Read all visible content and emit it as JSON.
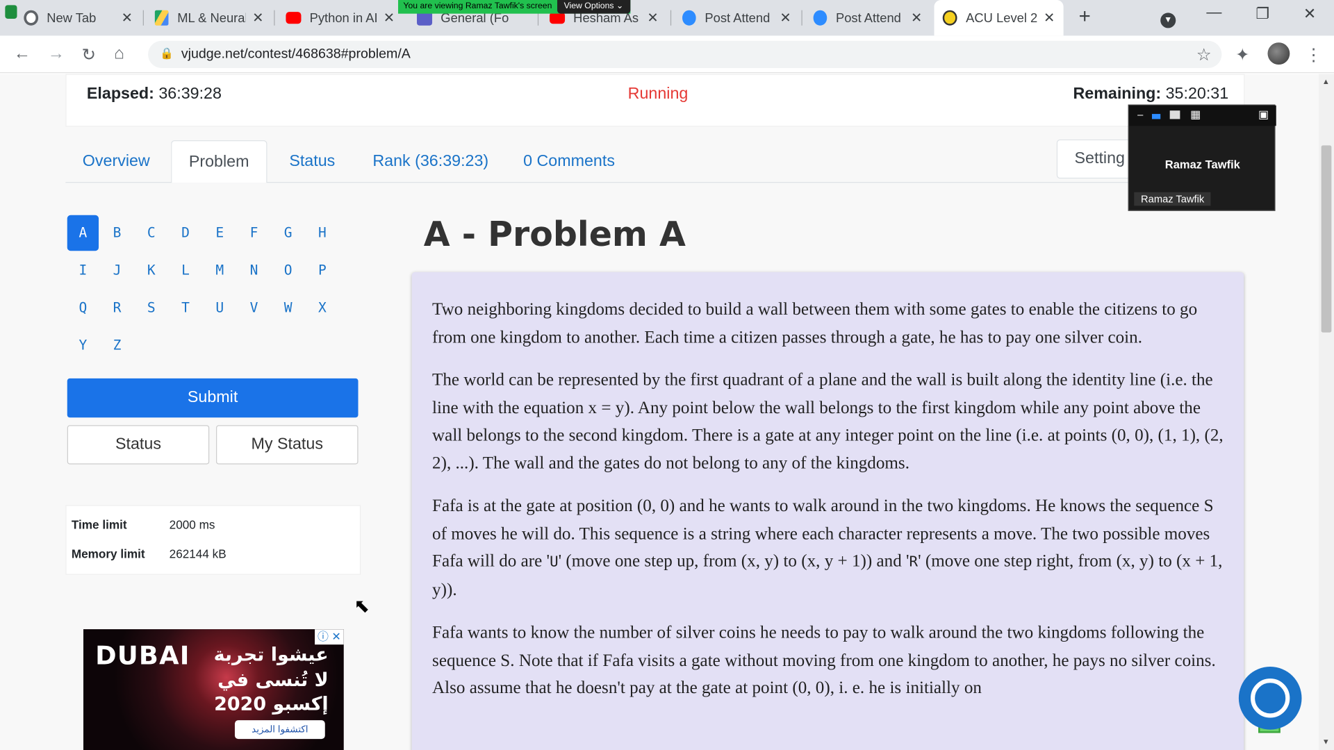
{
  "browser": {
    "tabs": [
      {
        "title": "New Tab",
        "favicon": "chrome-icon"
      },
      {
        "title": "ML & Neural",
        "favicon": "drive-icon"
      },
      {
        "title": "Python in AI",
        "favicon": "youtube-icon"
      },
      {
        "title": "General (Fo",
        "favicon": "teams-icon"
      },
      {
        "title": "Hesham As",
        "favicon": "youtube-icon"
      },
      {
        "title": "Post Attend",
        "favicon": "zoom-icon"
      },
      {
        "title": "Post Attend",
        "favicon": "zoom-icon"
      },
      {
        "title": "ACU Level 2",
        "favicon": "vjudge-icon",
        "active": true
      }
    ],
    "share_banner": {
      "text": "You are viewing Ramaz Tawfik's screen",
      "button": "View Options"
    },
    "url": "vjudge.net/contest/468638#problem/A"
  },
  "contest": {
    "elapsed_label": "Elapsed:",
    "elapsed_value": "36:39:28",
    "status": "Running",
    "remaining_label": "Remaining:",
    "remaining_value": "35:20:31"
  },
  "nav": {
    "tabs": [
      "Overview",
      "Problem",
      "Status",
      "Rank (36:39:23)",
      "0 Comments"
    ],
    "active": "Problem",
    "setting_label": "Setting"
  },
  "problems": {
    "letters": [
      "A",
      "B",
      "C",
      "D",
      "E",
      "F",
      "G",
      "H",
      "I",
      "J",
      "K",
      "L",
      "M",
      "N",
      "O",
      "P",
      "Q",
      "R",
      "S",
      "T",
      "U",
      "V",
      "W",
      "X",
      "Y",
      "Z"
    ],
    "selected": "A"
  },
  "actions": {
    "submit": "Submit",
    "status": "Status",
    "my_status": "My Status"
  },
  "limits": {
    "time_label": "Time limit",
    "time_value": "2000 ms",
    "memory_label": "Memory limit",
    "memory_value": "262144 kB"
  },
  "ad": {
    "logo": "DUBAI",
    "line1": "عيشوا تجربة",
    "line2": "لا تُنسى في",
    "line3": "إكسبو 2020",
    "cta": "اكتشفوا المزيد"
  },
  "problem": {
    "title": "A - Problem A",
    "p1": "Two neighboring kingdoms decided to build a wall between them with some gates to enable the citizens to go from one kingdom to another. Each time a citizen passes through a gate, he has to pay one silver coin.",
    "p2": "The world can be represented by the first quadrant of a plane and the wall is built along the identity line (i.e. the line with the equation x = y). Any point below the wall belongs to the first kingdom while any point above the wall belongs to the second kingdom. There is a gate at any integer point on the line (i.e. at points (0, 0), (1, 1), (2, 2), ...). The wall and the gates do not belong to any of the kingdoms.",
    "p3a": "Fafa is at the gate at position (0, 0) and he wants to walk around in the two kingdoms. He knows the sequence S of moves he will do. This sequence is a string where each character represents a move. The two possible moves Fafa will do are '",
    "p3_u": "U",
    "p3b": "' (move one step up, from (x, y) to (x, y + 1)) and '",
    "p3_r": "R",
    "p3c": "' (move one step right, from (x, y) to (x + 1, y)).",
    "p4": "Fafa wants to know the number of silver coins he needs to pay to walk around the two kingdoms following the sequence S. Note that if Fafa visits a gate without moving from one kingdom to another, he pays no silver coins. Also assume that he doesn't pay at the gate at point (0, 0), i. e. he is initially on"
  },
  "screen_share": {
    "name": "Ramaz Tawfik",
    "tag": "Ramaz Tawfik"
  }
}
